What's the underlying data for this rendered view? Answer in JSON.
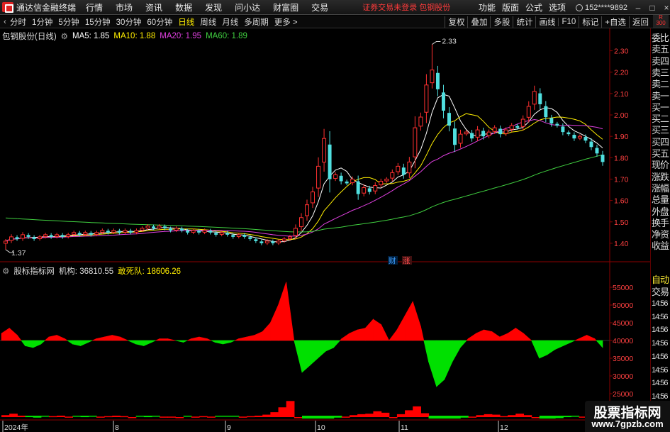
{
  "menubar": {
    "app_title": "通达信金融终端",
    "items": [
      "行情",
      "市场",
      "资讯",
      "数据",
      "发现",
      "问小达",
      "财富圈",
      "交易"
    ],
    "notice": "证券交易未登录  包钢股份",
    "right_items": [
      "功能",
      "版面",
      "公式",
      "选项"
    ],
    "user": "152****9892",
    "window_buttons": [
      "–",
      "□",
      "×"
    ]
  },
  "corner_badge": {
    "top": "R",
    "bottom": "300"
  },
  "toolbar": {
    "periods": [
      "分时",
      "1分钟",
      "5分钟",
      "15分钟",
      "30分钟",
      "60分钟",
      "日线",
      "周线",
      "月线",
      "多周期",
      "更多 >"
    ],
    "active_period": "日线",
    "tools": [
      "复权",
      "叠加",
      "多股",
      "统计",
      "画线",
      "F10",
      "标记",
      "+自选",
      "返回"
    ]
  },
  "main_legend": {
    "stock": "包钢股份(日线)",
    "ma5": "MA5: 1.85",
    "ma10": "MA10: 1.88",
    "ma20": "MA20: 1.95",
    "ma60": "MA60: 1.89"
  },
  "indicator_legend": {
    "name": "股标指标网",
    "jigou": "机构: 36810.55",
    "gansidui": "敢死队: 18606.26"
  },
  "price_axis": [
    "2.30",
    "2.20",
    "2.10",
    "2.00",
    "1.90",
    "1.80",
    "1.70",
    "1.60",
    "1.50",
    "1.40"
  ],
  "indicator_axis": [
    "55000",
    "50000",
    "45000",
    "40000",
    "35000",
    "30000",
    "25000"
  ],
  "annotations": {
    "high": "2.33",
    "low": "1.37",
    "cai": "财",
    "zhang": "涨"
  },
  "date_axis": [
    "2024年",
    "8",
    "9",
    "10",
    "11",
    "12"
  ],
  "side_panel": {
    "labels": [
      "委比",
      "卖五",
      "卖四",
      "卖三",
      "卖二",
      "卖一",
      "买一",
      "买二",
      "买三",
      "买四",
      "买五",
      "现价",
      "涨跌",
      "涨幅",
      "总量",
      "外盘",
      "换手",
      "净资",
      "收益"
    ],
    "auto": "自动",
    "trade": "交易",
    "times": [
      "14:56",
      "14:56",
      "14:56",
      "14:56",
      "14:56",
      "14:56",
      "14:56",
      "14:56",
      "14:56"
    ]
  },
  "watermark": {
    "line1": "股票指标网",
    "line2": "www.7gpzb.com"
  },
  "colors": {
    "up": "#ff3030",
    "down": "#50e0e0",
    "ma5": "#ffffff",
    "ma10": "#ffee00",
    "ma20": "#e040e0",
    "ma60": "#40d040",
    "indicator_up": "#ff0000",
    "indicator_down": "#00e000",
    "grid": "#8b0000"
  },
  "chart_data": [
    {
      "type": "candlestick",
      "title": "包钢股份(日线)",
      "ylim": [
        1.35,
        2.34
      ],
      "high": 2.33,
      "low": 1.37,
      "x_labels": [
        "2024年",
        "8",
        "9",
        "10",
        "11",
        "12"
      ],
      "closes": [
        1.41,
        1.43,
        1.42,
        1.44,
        1.43,
        1.42,
        1.43,
        1.44,
        1.43,
        1.44,
        1.43,
        1.44,
        1.45,
        1.44,
        1.45,
        1.44,
        1.45,
        1.46,
        1.45,
        1.46,
        1.45,
        1.46,
        1.45,
        1.46,
        1.47,
        1.48,
        1.47,
        1.48,
        1.47,
        1.46,
        1.47,
        1.46,
        1.45,
        1.46,
        1.45,
        1.46,
        1.45,
        1.44,
        1.45,
        1.44,
        1.43,
        1.44,
        1.43,
        1.42,
        1.41,
        1.4,
        1.41,
        1.4,
        1.41,
        1.42,
        1.43,
        1.47,
        1.52,
        1.58,
        1.64,
        1.76,
        1.89,
        1.7,
        1.72,
        1.69,
        1.68,
        1.7,
        1.63,
        1.66,
        1.64,
        1.67,
        1.69,
        1.7,
        1.73,
        1.76,
        1.72,
        1.78,
        1.94,
        1.99,
        2.14,
        2.21,
        2.12,
        2.02,
        1.95,
        1.86,
        1.91,
        1.92,
        1.89,
        1.93,
        1.9,
        1.92,
        1.94,
        1.91,
        1.93,
        1.95,
        1.94,
        1.98,
        2.04,
        2.11,
        2.05,
        1.99,
        1.96,
        1.95,
        1.92,
        1.91,
        1.89,
        1.9,
        1.88,
        1.85,
        1.82,
        1.78
      ]
    },
    {
      "type": "area",
      "title": "股标指标网",
      "series": [
        {
          "name": "机构",
          "last": 36810.55
        },
        {
          "name": "敢死队",
          "last": 18606.26
        }
      ],
      "ylim": [
        25000,
        57000
      ],
      "baseline": 40000,
      "values": [
        42000,
        43500,
        41500,
        38500,
        38000,
        39000,
        41000,
        41500,
        40500,
        39000,
        38500,
        39500,
        40500,
        41000,
        41500,
        41000,
        40000,
        39000,
        38500,
        39500,
        40500,
        40500,
        40000,
        39500,
        40500,
        41000,
        40500,
        39500,
        39000,
        39500,
        40500,
        41000,
        41500,
        42500,
        45000,
        50000,
        56500,
        40000,
        31000,
        33000,
        35000,
        37000,
        38000,
        40500,
        42000,
        43000,
        43500,
        46000,
        44500,
        40000,
        43000,
        47000,
        51000,
        44000,
        34000,
        27000,
        29000,
        34000,
        38000,
        40500,
        42000,
        43000,
        42500,
        41000,
        42000,
        43500,
        42000,
        40000,
        35000,
        36000,
        37500,
        38500,
        39500,
        40500,
        41500,
        40500,
        38000
      ]
    }
  ]
}
